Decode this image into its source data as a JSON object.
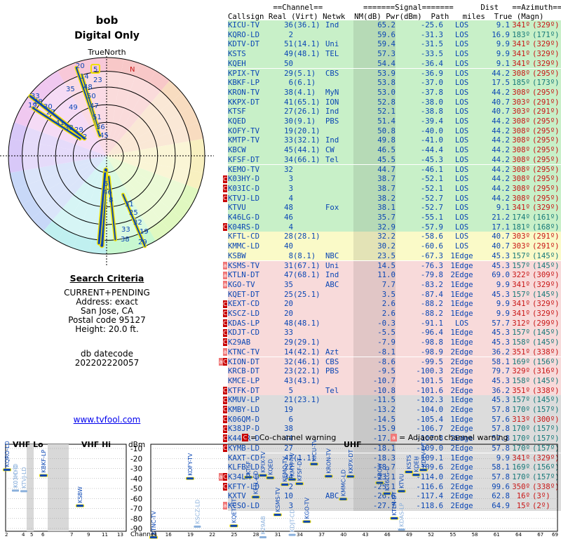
{
  "title": "bob",
  "subtitle": "Digital Only",
  "polar": {
    "north_label": "TrueNorth",
    "n_label": "N"
  },
  "criteria": {
    "heading": "Search Criteria",
    "lines": [
      "CURRENT+PENDING",
      "Address: exact",
      "San Jose, CA",
      "Postal code 95127",
      "Height: 20.0 ft."
    ],
    "datecode_label": "db datecode",
    "datecode": "202202220057"
  },
  "link": "www.tvfool.com",
  "headers": {
    "l1": "          ==Channel==         =======Signal=======      Dist   ==Azimuth==",
    "l2": "Callsign Real (Virt) Netwk  NM(dB) Pwr(dBm)  Path   miles  True (Magn)"
  },
  "colors": {
    "green": "#c8f0c8",
    "yellow": "#fafac8",
    "pink": "#f8dada",
    "gray": "#dcdcdc",
    "blue": "#0a46b4",
    "red": "#c81414",
    "teal": "#147878",
    "warn": "#c80000"
  },
  "rows": [
    {
      "cs": "KICU-TV",
      "r": "36",
      "v": "(36.1)",
      "n": "Ind",
      "nm": "65.2",
      "pw": "-25.6",
      "pa": "LOS",
      "d": "9.1",
      "t": "341º",
      "m": "(329º)",
      "bg": "green",
      "az": "red",
      "w": ""
    },
    {
      "cs": "KQRO-LD",
      "r": "2",
      "v": "",
      "n": "",
      "nm": "59.6",
      "pw": "-31.3",
      "pa": "LOS",
      "d": "16.9",
      "t": "183º",
      "m": "(171º)",
      "bg": "green",
      "az": "teal",
      "w": ""
    },
    {
      "cs": "KDTV-DT",
      "r": "51",
      "v": "(14.1)",
      "n": "Uni",
      "nm": "59.4",
      "pw": "-31.5",
      "pa": "LOS",
      "d": "9.9",
      "t": "341º",
      "m": "(329º)",
      "bg": "green",
      "az": "red",
      "w": ""
    },
    {
      "cs": "KSTS",
      "r": "49",
      "v": "(48.1)",
      "n": "TEL",
      "nm": "57.3",
      "pw": "-33.5",
      "pa": "LOS",
      "d": "9.9",
      "t": "341º",
      "m": "(329º)",
      "bg": "green",
      "az": "red",
      "w": ""
    },
    {
      "cs": "KQEH",
      "r": "50",
      "v": "",
      "n": "",
      "nm": "54.4",
      "pw": "-36.4",
      "pa": "LOS",
      "d": "9.1",
      "t": "341º",
      "m": "(329º)",
      "bg": "green",
      "az": "red",
      "w": ""
    },
    {
      "cs": "KPIX-TV",
      "r": "29",
      "v": "(5.1)",
      "n": "CBS",
      "nm": "53.9",
      "pw": "-36.9",
      "pa": "LOS",
      "d": "44.2",
      "t": "308º",
      "m": "(295º)",
      "bg": "green",
      "az": "red",
      "w": ""
    },
    {
      "cs": "KBKF-LP",
      "r": "6",
      "v": "(6.1)",
      "n": "",
      "nm": "53.8",
      "pw": "-37.0",
      "pa": "LOS",
      "d": "17.5",
      "t": "185º",
      "m": "(173º)",
      "bg": "green",
      "az": "teal",
      "w": ""
    },
    {
      "cs": "KRON-TV",
      "r": "38",
      "v": "(4.1)",
      "n": "MyN",
      "nm": "53.0",
      "pw": "-37.8",
      "pa": "LOS",
      "d": "44.2",
      "t": "308º",
      "m": "(295º)",
      "bg": "green",
      "az": "red",
      "w": ""
    },
    {
      "cs": "KKPX-DT",
      "r": "41",
      "v": "(65.1)",
      "n": "ION",
      "nm": "52.8",
      "pw": "-38.0",
      "pa": "LOS",
      "d": "40.7",
      "t": "303º",
      "m": "(291º)",
      "bg": "green",
      "az": "red",
      "w": ""
    },
    {
      "cs": "KTSF",
      "r": "27",
      "v": "(26.1)",
      "n": "Ind",
      "nm": "52.1",
      "pw": "-38.8",
      "pa": "LOS",
      "d": "40.7",
      "t": "303º",
      "m": "(291º)",
      "bg": "green",
      "az": "red",
      "w": ""
    },
    {
      "cs": "KQED",
      "r": "30",
      "v": "(9.1)",
      "n": "PBS",
      "nm": "51.4",
      "pw": "-39.4",
      "pa": "LOS",
      "d": "44.2",
      "t": "308º",
      "m": "(295º)",
      "bg": "green",
      "az": "red",
      "w": ""
    },
    {
      "cs": "KOFY-TV",
      "r": "19",
      "v": "(20.1)",
      "n": "",
      "nm": "50.8",
      "pw": "-40.0",
      "pa": "LOS",
      "d": "44.2",
      "t": "308º",
      "m": "(295º)",
      "bg": "green",
      "az": "red",
      "w": ""
    },
    {
      "cs": "KMTP-TV",
      "r": "33",
      "v": "(32.1)",
      "n": "Ind",
      "nm": "49.8",
      "pw": "-41.0",
      "pa": "LOS",
      "d": "44.2",
      "t": "308º",
      "m": "(295º)",
      "bg": "green",
      "az": "red",
      "w": ""
    },
    {
      "cs": "KBCW",
      "r": "45",
      "v": "(44.1)",
      "n": "CW",
      "nm": "46.5",
      "pw": "-44.4",
      "pa": "LOS",
      "d": "44.2",
      "t": "308º",
      "m": "(295º)",
      "bg": "green",
      "az": "red",
      "w": ""
    },
    {
      "cs": "KFSF-DT",
      "r": "34",
      "v": "(66.1)",
      "n": "Tel",
      "nm": "45.5",
      "pw": "-45.3",
      "pa": "LOS",
      "d": "44.2",
      "t": "308º",
      "m": "(295º)",
      "bg": "green",
      "az": "red",
      "w": ""
    },
    {
      "cs": "KEMO-TV",
      "r": "32",
      "v": "",
      "n": "",
      "nm": "44.7",
      "pw": "-46.1",
      "pa": "LOS",
      "d": "44.2",
      "t": "308º",
      "m": "(295º)",
      "bg": "green",
      "az": "red",
      "w": ""
    },
    {
      "cs": "K03HY-D",
      "r": "3",
      "v": "",
      "n": "",
      "nm": "38.7",
      "pw": "-52.1",
      "pa": "LOS",
      "d": "44.2",
      "t": "308º",
      "m": "(295º)",
      "bg": "green",
      "az": "red",
      "w": "C"
    },
    {
      "cs": "K03IC-D",
      "r": "3",
      "v": "",
      "n": "",
      "nm": "38.7",
      "pw": "-52.1",
      "pa": "LOS",
      "d": "44.2",
      "t": "308º",
      "m": "(295º)",
      "bg": "green",
      "az": "red",
      "w": "C"
    },
    {
      "cs": "KTVJ-LD",
      "r": "4",
      "v": "",
      "n": "",
      "nm": "38.2",
      "pw": "-52.7",
      "pa": "LOS",
      "d": "44.2",
      "t": "308º",
      "m": "(295º)",
      "bg": "green",
      "az": "red",
      "w": "C"
    },
    {
      "cs": "KTVU",
      "r": "48",
      "v": "",
      "n": "Fox",
      "nm": "38.1",
      "pw": "-52.7",
      "pa": "LOS",
      "d": "9.1",
      "t": "341º",
      "m": "(329º)",
      "bg": "green",
      "az": "red",
      "w": ""
    },
    {
      "cs": "K46LG-D",
      "r": "46",
      "v": "",
      "n": "",
      "nm": "35.7",
      "pw": "-55.1",
      "pa": "LOS",
      "d": "21.2",
      "t": "174º",
      "m": "(161º)",
      "bg": "green",
      "az": "teal",
      "w": ""
    },
    {
      "cs": "K04RS-D",
      "r": "4",
      "v": "",
      "n": "",
      "nm": "32.9",
      "pw": "-57.9",
      "pa": "LOS",
      "d": "17.1",
      "t": "181º",
      "m": "(168º)",
      "bg": "green",
      "az": "teal",
      "w": "C"
    },
    {
      "cs": "KFTL-CD",
      "r": "28",
      "v": "(28.1)",
      "n": "",
      "nm": "32.2",
      "pw": "-58.6",
      "pa": "LOS",
      "d": "40.7",
      "t": "303º",
      "m": "(291º)",
      "bg": "yellow",
      "az": "red",
      "w": ""
    },
    {
      "cs": "KMMC-LD",
      "r": "40",
      "v": "",
      "n": "",
      "nm": "30.2",
      "pw": "-60.6",
      "pa": "LOS",
      "d": "40.7",
      "t": "303º",
      "m": "(291º)",
      "bg": "yellow",
      "az": "red",
      "w": ""
    },
    {
      "cs": "KSBW",
      "r": "8",
      "v": "(8.1)",
      "n": "NBC",
      "nm": "23.5",
      "pw": "-67.3",
      "pa": "1Edge",
      "d": "45.3",
      "t": "157º",
      "m": "(145º)",
      "bg": "yellow",
      "az": "teal",
      "w": ""
    },
    {
      "cs": "KSMS-TV",
      "r": "31",
      "v": "(67.1)",
      "n": "Uni",
      "nm": "14.5",
      "pw": "-76.3",
      "pa": "1Edge",
      "d": "45.3",
      "t": "157º",
      "m": "(145º)",
      "bg": "pink",
      "az": "teal",
      "w": "a"
    },
    {
      "cs": "KTLN-DT",
      "r": "47",
      "v": "(68.1)",
      "n": "Ind",
      "nm": "11.0",
      "pw": "-79.8",
      "pa": "2Edge",
      "d": "69.0",
      "t": "322º",
      "m": "(309º)",
      "bg": "pink",
      "az": "red",
      "w": "a"
    },
    {
      "cs": "KGO-TV",
      "r": "35",
      "v": "",
      "n": "ABC",
      "nm": "7.7",
      "pw": "-83.2",
      "pa": "1Edge",
      "d": "9.9",
      "t": "341º",
      "m": "(329º)",
      "bg": "pink",
      "az": "red",
      "w": "a"
    },
    {
      "cs": "KQET-DT",
      "r": "25",
      "v": "(25.1)",
      "n": "",
      "nm": "3.5",
      "pw": "-87.4",
      "pa": "1Edge",
      "d": "45.3",
      "t": "157º",
      "m": "(145º)",
      "bg": "pink",
      "az": "teal",
      "w": ""
    },
    {
      "cs": "KEXT-CD",
      "r": "20",
      "v": "",
      "n": "",
      "nm": "2.6",
      "pw": "-88.2",
      "pa": "1Edge",
      "d": "9.9",
      "t": "341º",
      "m": "(329º)",
      "bg": "pink",
      "az": "red",
      "w": "C"
    },
    {
      "cs": "KSCZ-LD",
      "r": "20",
      "v": "",
      "n": "",
      "nm": "2.6",
      "pw": "-88.2",
      "pa": "1Edge",
      "d": "9.9",
      "t": "341º",
      "m": "(329º)",
      "bg": "pink",
      "az": "red",
      "w": "C"
    },
    {
      "cs": "KDAS-LP",
      "r": "48",
      "v": "(48.1)",
      "n": "",
      "nm": "-0.3",
      "pw": "-91.1",
      "pa": "LOS",
      "d": "57.7",
      "t": "312º",
      "m": "(299º)",
      "bg": "pink",
      "az": "red",
      "w": "C"
    },
    {
      "cs": "KDJT-CD",
      "r": "33",
      "v": "",
      "n": "",
      "nm": "-5.5",
      "pw": "-96.4",
      "pa": "1Edge",
      "d": "45.3",
      "t": "157º",
      "m": "(145º)",
      "bg": "pink",
      "az": "teal",
      "w": "C"
    },
    {
      "cs": "K29AB",
      "r": "29",
      "v": "(29.1)",
      "n": "",
      "nm": "-7.9",
      "pw": "-98.8",
      "pa": "1Edge",
      "d": "45.3",
      "t": "158º",
      "m": "(145º)",
      "bg": "pink",
      "az": "teal",
      "w": "C"
    },
    {
      "cs": "KTNC-TV",
      "r": "14",
      "v": "(42.1)",
      "n": "Azt",
      "nm": "-8.1",
      "pw": "-98.9",
      "pa": "2Edge",
      "d": "36.2",
      "t": "351º",
      "m": "(338º)",
      "bg": "pink",
      "az": "red",
      "w": "a"
    },
    {
      "cs": "KION-DT",
      "r": "32",
      "v": "(46.1)",
      "n": "CBS",
      "nm": "-8.6",
      "pw": "-99.5",
      "pa": "2Edge",
      "d": "58.1",
      "t": "169º",
      "m": "(156º)",
      "bg": "pink",
      "az": "teal",
      "w": "aC"
    },
    {
      "cs": "KRCB-DT",
      "r": "23",
      "v": "(22.1)",
      "n": "PBS",
      "nm": "-9.5",
      "pw": "-100.3",
      "pa": "2Edge",
      "d": "79.7",
      "t": "329º",
      "m": "(316º)",
      "bg": "pink",
      "az": "red",
      "w": ""
    },
    {
      "cs": "KMCE-LP",
      "r": "43",
      "v": "(43.1)",
      "n": "",
      "nm": "-10.7",
      "pw": "-101.5",
      "pa": "1Edge",
      "d": "45.3",
      "t": "158º",
      "m": "(145º)",
      "bg": "pink",
      "az": "teal",
      "w": ""
    },
    {
      "cs": "KTFK-DT",
      "r": "5",
      "v": "",
      "n": "Tel",
      "nm": "-10.8",
      "pw": "-101.6",
      "pa": "2Edge",
      "d": "36.2",
      "t": "351º",
      "m": "(338º)",
      "bg": "pink",
      "az": "red",
      "w": "C"
    },
    {
      "cs": "KMUV-LP",
      "r": "21",
      "v": "(23.1)",
      "n": "",
      "nm": "-11.5",
      "pw": "-102.3",
      "pa": "1Edge",
      "d": "45.3",
      "t": "157º",
      "m": "(145º)",
      "bg": "gray",
      "az": "teal",
      "w": "C"
    },
    {
      "cs": "KMBY-LD",
      "r": "19",
      "v": "",
      "n": "",
      "nm": "-13.2",
      "pw": "-104.0",
      "pa": "2Edge",
      "d": "57.8",
      "t": "170º",
      "m": "(157º)",
      "bg": "gray",
      "az": "teal",
      "w": "C"
    },
    {
      "cs": "K06QM-D",
      "r": "6",
      "v": "",
      "n": "",
      "nm": "-14.5",
      "pw": "-105.4",
      "pa": "1Edge",
      "d": "57.6",
      "t": "313º",
      "m": "(300º)",
      "bg": "gray",
      "az": "red",
      "w": "C"
    },
    {
      "cs": "K38JP-D",
      "r": "38",
      "v": "",
      "n": "",
      "nm": "-15.9",
      "pw": "-106.7",
      "pa": "2Edge",
      "d": "57.8",
      "t": "170º",
      "m": "(157º)",
      "bg": "gray",
      "az": "teal",
      "w": "C"
    },
    {
      "cs": "K44KR-D",
      "r": "44",
      "v": "",
      "n": "",
      "nm": "-17.0",
      "pw": "-107.8",
      "pa": "2Edge",
      "d": "57.8",
      "t": "170º",
      "m": "(157º)",
      "bg": "gray",
      "az": "teal",
      "w": "C"
    },
    {
      "cs": "KYMB-LD",
      "r": "27",
      "v": "",
      "n": "",
      "nm": "-18.1",
      "pw": "-109.0",
      "pa": "2Edge",
      "d": "57.8",
      "t": "170º",
      "m": "(157º)",
      "bg": "gray",
      "az": "teal",
      "w": "C"
    },
    {
      "cs": "KAXT-CD",
      "r": "42",
      "v": "(1.1)",
      "n": "",
      "nm": "-18.3",
      "pw": "-109.1",
      "pa": "1Edge",
      "d": "9.9",
      "t": "341º",
      "m": "(329º)",
      "bg": "gray",
      "az": "red",
      "w": ""
    },
    {
      "cs": "KLFB-LD",
      "r": "22",
      "v": "",
      "n": "",
      "nm": "-18.7",
      "pw": "-109.6",
      "pa": "2Edge",
      "d": "58.1",
      "t": "169º",
      "m": "(156º)",
      "bg": "gray",
      "az": "teal",
      "w": ""
    },
    {
      "cs": "K34LR-D",
      "r": "34",
      "v": "",
      "n": "",
      "nm": "-23.1",
      "pw": "-114.0",
      "pa": "2Edge",
      "d": "57.8",
      "t": "170º",
      "m": "(157º)",
      "bg": "gray",
      "az": "teal",
      "w": "aC"
    },
    {
      "cs": "KFTY-LD",
      "r": "2",
      "v": "",
      "n": "",
      "nm": "-25.1",
      "pw": "-116.6",
      "pa": "2Edge",
      "d": "99.6",
      "t": "350º",
      "m": "(338º)",
      "bg": "gray",
      "az": "red",
      "w": "C"
    },
    {
      "cs": "KXTV",
      "r": "10",
      "v": "",
      "n": "ABC",
      "nm": "-26.6",
      "pw": "-117.4",
      "pa": "2Edge",
      "d": "62.8",
      "t": "16º",
      "m": "(3º)",
      "bg": "gray",
      "az": "red",
      "w": ""
    },
    {
      "cs": "KCSO-LD",
      "r": "3",
      "v": "",
      "n": "",
      "nm": "-27.7",
      "pw": "-118.6",
      "pa": "2Edge",
      "d": "64.9",
      "t": "15º",
      "m": "(2º)",
      "bg": "gray",
      "az": "red",
      "w": "a"
    }
  ],
  "legend": {
    "co": "= Co-channel warning",
    "adj": "= Adjacent channel warning"
  },
  "spectrum": {
    "vhf_lo": "VHF Lo",
    "vhf_hi": "VHF Hi",
    "uhf": "UHF",
    "dbm": "dBm",
    "channel": "Channel",
    "ylabels": [
      "-10",
      "-20",
      "-30",
      "-40",
      "-50",
      "-60",
      "-70",
      "-80",
      "-90"
    ],
    "vhf_ticks": [
      "2",
      "4",
      "5",
      "6",
      "7",
      "9",
      "11",
      "13"
    ],
    "uhf_ticks": [
      "14",
      "16",
      "19",
      "22",
      "25",
      "28",
      "31",
      "34",
      "37",
      "40",
      "43",
      "46",
      "49",
      "52",
      "55",
      "58",
      "61",
      "64",
      "67",
      "69"
    ],
    "stations": [
      {
        "cs": "KQRO-LD",
        "ch": 2,
        "p": -31.3,
        "dim": false
      },
      {
        "cs": "K03HY-D",
        "ch": 3,
        "p": -52.1,
        "dim": true
      },
      {
        "cs": "K03IC-D",
        "ch": 3,
        "p": -52.1,
        "dim": true
      },
      {
        "cs": "KTVJ-LD",
        "ch": 4,
        "p": -52.7,
        "dim": true
      },
      {
        "cs": "KBKF-LP",
        "ch": 6,
        "p": -37.0,
        "dim": false
      },
      {
        "cs": "KSBW",
        "ch": 8,
        "p": -67.3,
        "dim": false
      },
      {
        "cs": "KTNC-TV",
        "ch": 14,
        "p": -98.9,
        "dim": false
      },
      {
        "cs": "KOFY-TV",
        "ch": 19,
        "p": -40.0,
        "dim": false
      },
      {
        "cs": "KSCZ-LD",
        "ch": 20,
        "p": -88.2,
        "dim": true
      },
      {
        "cs": "KQET-DT",
        "ch": 25,
        "p": -87.4,
        "dim": false
      },
      {
        "cs": "KTSF",
        "ch": 27,
        "p": -38.8,
        "dim": false
      },
      {
        "cs": "KFTL-CD",
        "ch": 28,
        "p": -58.6,
        "dim": false
      },
      {
        "cs": "KPIX-TV",
        "ch": 29,
        "p": -36.9,
        "dim": false
      },
      {
        "cs": "K29AB",
        "ch": 29,
        "p": -98.8,
        "dim": true
      },
      {
        "cs": "KQED",
        "ch": 30,
        "p": -39.4,
        "dim": false
      },
      {
        "cs": "KSMS-TV",
        "ch": 31,
        "p": -76.3,
        "dim": false
      },
      {
        "cs": "KEMO-TV",
        "ch": 32,
        "p": -46.1,
        "dim": false
      },
      {
        "cs": "KMTP-TV",
        "ch": 33,
        "p": -41.0,
        "dim": false
      },
      {
        "cs": "KDJT-CD",
        "ch": 33,
        "p": -96.4,
        "dim": true
      },
      {
        "cs": "KFSF-DT",
        "ch": 34,
        "p": -45.3,
        "dim": false
      },
      {
        "cs": "KGO-TV",
        "ch": 35,
        "p": -83.2,
        "dim": false
      },
      {
        "cs": "KICU-TV",
        "ch": 36,
        "p": -25.6,
        "dim": false
      },
      {
        "cs": "KRON-TV",
        "ch": 38,
        "p": -37.8,
        "dim": false
      },
      {
        "cs": "KMMC-LD",
        "ch": 40,
        "p": -60.6,
        "dim": false
      },
      {
        "cs": "KKPX-DT",
        "ch": 41,
        "p": -38.0,
        "dim": false
      },
      {
        "cs": "KBCW",
        "ch": 45,
        "p": -44.4,
        "dim": false
      },
      {
        "cs": "K46LG-D",
        "ch": 46,
        "p": -55.1,
        "dim": false
      },
      {
        "cs": "KTLN-DT",
        "ch": 47,
        "p": -79.8,
        "dim": false
      },
      {
        "cs": "KTVU",
        "ch": 48,
        "p": -52.7,
        "dim": false
      },
      {
        "cs": "KDAS-LP",
        "ch": 48,
        "p": -91.1,
        "dim": true
      },
      {
        "cs": "KSTS",
        "ch": 49,
        "p": -33.5,
        "dim": false
      },
      {
        "cs": "KQEH",
        "ch": 50,
        "p": -36.4,
        "dim": false
      },
      {
        "cs": "KDTV-DT",
        "ch": 51,
        "p": -31.5,
        "dim": false
      }
    ]
  },
  "polar_labels": [
    {
      "t": "5",
      "hl": true
    },
    {
      "t": "20",
      "hl": false
    },
    {
      "t": "14",
      "hl": false
    },
    {
      "t": "23",
      "hl": false
    },
    {
      "t": "35",
      "hl": false
    },
    {
      "t": "48",
      "hl": false
    },
    {
      "t": "50",
      "hl": false
    },
    {
      "t": "47",
      "hl": false
    },
    {
      "t": "49",
      "hl": false
    },
    {
      "t": "51",
      "hl": false
    },
    {
      "t": "36",
      "hl": false
    },
    {
      "t": "45",
      "hl": false
    },
    {
      "t": "33",
      "hl": false
    },
    {
      "t": "28",
      "hl": false
    },
    {
      "t": "19",
      "hl": false
    },
    {
      "t": "30",
      "hl": false
    },
    {
      "t": "27",
      "hl": false
    },
    {
      "t": "41",
      "hl": false
    },
    {
      "t": "38",
      "hl": false
    },
    {
      "t": "29",
      "hl": false
    },
    {
      "t": "2",
      "hl": false
    },
    {
      "t": "6",
      "hl": false
    },
    {
      "t": "46",
      "hl": false
    },
    {
      "t": "8",
      "hl": false
    },
    {
      "t": "31",
      "hl": false
    },
    {
      "t": "25",
      "hl": false
    },
    {
      "t": "32",
      "hl": false
    },
    {
      "t": "33",
      "hl": false
    },
    {
      "t": "19",
      "hl": false
    },
    {
      "t": "38",
      "hl": false
    },
    {
      "t": "29",
      "hl": false
    }
  ]
}
